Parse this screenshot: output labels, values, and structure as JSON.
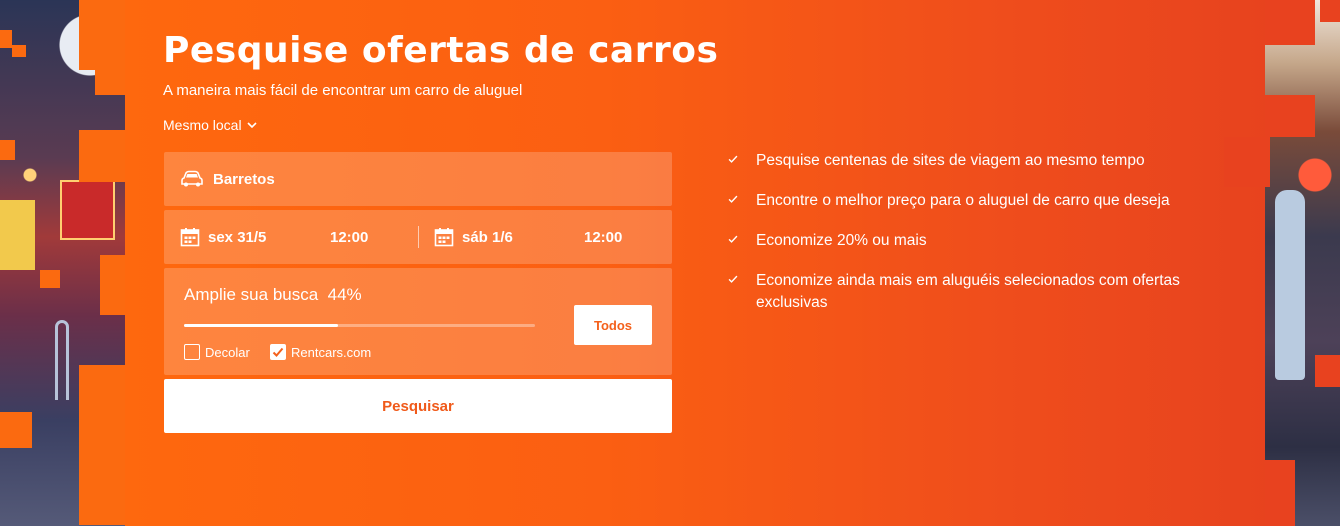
{
  "hero": {
    "title": "Pesquise ofertas de carros",
    "subtitle": "A maneira mais fácil de encontrar um carro de aluguel",
    "location_mode": "Mesmo local"
  },
  "form": {
    "location": "Barretos",
    "pickup": {
      "date": "sex 31/5",
      "time": "12:00"
    },
    "dropoff": {
      "date": "sáb 1/6",
      "time": "12:00"
    },
    "expand": {
      "label": "Amplie sua busca",
      "percent_text": "44%",
      "percent": 44,
      "all_button": "Todos",
      "providers": [
        {
          "label": "Decolar",
          "checked": false
        },
        {
          "label": "Rentcars.com",
          "checked": true
        }
      ]
    },
    "search_button": "Pesquisar"
  },
  "benefits": [
    "Pesquise centenas de sites de viagem ao mesmo tempo",
    "Encontre o melhor preço para o aluguel de carro que deseja",
    "Economize 20% ou mais",
    "Economize ainda mais em aluguéis selecionados com ofertas exclusivas"
  ],
  "icons": {
    "location": "car-icon",
    "date": "calendar-icon",
    "dropdown": "chevron-down-icon",
    "benefit": "check-icon"
  },
  "colors": {
    "accent": "#ff6a0d",
    "button_text": "#f05a1a"
  }
}
